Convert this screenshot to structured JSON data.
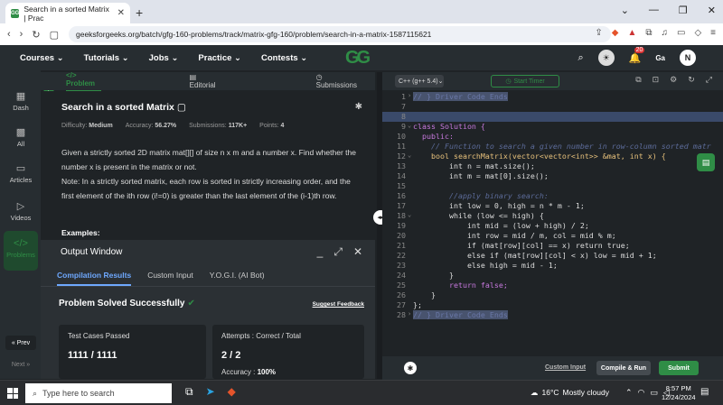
{
  "browser": {
    "tab_title": "Search in a sorted Matrix | Prac",
    "url": "geeksforgeeks.org/batch/gfg-160-problems/track/matrix-gfg-160/problem/search-in-a-matrix-1587115621",
    "window_controls": [
      "⌄",
      "—",
      "❐",
      "✕"
    ]
  },
  "site_nav": {
    "items": [
      "Courses ⌄",
      "Tutorials ⌄",
      "Jobs ⌄",
      "Practice ⌄",
      "Contests ⌄"
    ],
    "logo": "GG",
    "notification_count": "20",
    "avatar_letter": "N"
  },
  "sidebar": {
    "items": [
      "Dash",
      "All",
      "Articles",
      "Videos",
      "Problems"
    ],
    "prev": "« Prev",
    "next": "Next »"
  },
  "problem_tabs": [
    "</> Problem",
    "Editorial",
    "Submissions"
  ],
  "problem": {
    "title": "Search in a sorted Matrix",
    "difficulty_label": "Difficulty:",
    "difficulty": "Medium",
    "accuracy_label": "Accuracy:",
    "accuracy": "56.27%",
    "submissions_label": "Submissions:",
    "submissions": "117K+",
    "points_label": "Points:",
    "points": "4",
    "desc_1": "Given a strictly sorted 2D matrix mat[][] of size n x m and a number x. Find whether the number x is present in the matrix or not.",
    "desc_2": "Note: In a strictly sorted matrix, each row is sorted in strictly increasing order, and the first element of the ith row (i!=0) is greater than the last element of the (i-1)th row.",
    "examples": "Examples:"
  },
  "output": {
    "title": "Output Window",
    "tabs": [
      "Compilation Results",
      "Custom Input",
      "Y.O.G.I. (AI Bot)"
    ],
    "status": "Problem Solved Successfully",
    "feedback": "Suggest Feedback",
    "tests_label": "Test Cases Passed",
    "tests_value": "1111 / 1111",
    "attempts_label": "Attempts : Correct / Total",
    "attempts_value": "2 / 2",
    "accuracy_label": "Accuracy :",
    "accuracy_value": "100%"
  },
  "editor": {
    "language": "C++ (g++ 5.4)",
    "timer": "Start Timer",
    "custom_input": "Custom Input",
    "compile_run": "Compile & Run",
    "submit": "Submit",
    "lines": [
      {
        "n": "1",
        "text": "// } Driver Code Ends"
      },
      {
        "n": "7",
        "text": ""
      },
      {
        "n": "8",
        "text": ""
      },
      {
        "n": "9",
        "text": "class Solution {"
      },
      {
        "n": "10",
        "text": "  public:"
      },
      {
        "n": "11",
        "text": "    // Function to search a given number in row-column sorted matr"
      },
      {
        "n": "12",
        "text": "    bool searchMatrix(vector<vector<int>> &mat, int x) {"
      },
      {
        "n": "13",
        "text": "        int n = mat.size();"
      },
      {
        "n": "14",
        "text": "        int m = mat[0].size();"
      },
      {
        "n": "15",
        "text": ""
      },
      {
        "n": "16",
        "text": "        //apply binary search:"
      },
      {
        "n": "17",
        "text": "        int low = 0, high = n * m - 1;"
      },
      {
        "n": "18",
        "text": "        while (low <= high) {"
      },
      {
        "n": "19",
        "text": "            int mid = (low + high) / 2;"
      },
      {
        "n": "20",
        "text": "            int row = mid / m, col = mid % m;"
      },
      {
        "n": "21",
        "text": "            if (mat[row][col] == x) return true;"
      },
      {
        "n": "22",
        "text": "            else if (mat[row][col] < x) low = mid + 1;"
      },
      {
        "n": "23",
        "text": "            else high = mid - 1;"
      },
      {
        "n": "24",
        "text": "        }"
      },
      {
        "n": "25",
        "text": "        return false;"
      },
      {
        "n": "26",
        "text": "    }"
      },
      {
        "n": "27",
        "text": "};"
      },
      {
        "n": "28",
        "text": "// } Driver Code Ends"
      }
    ]
  },
  "taskbar": {
    "search_placeholder": "Type here to search",
    "temperature": "16°C",
    "weather": "Mostly cloudy",
    "time": "8:57 PM",
    "date": "12/24/2024"
  },
  "colors": {
    "brand_green": "#2f8d46",
    "link_blue": "#6ea8fe"
  }
}
